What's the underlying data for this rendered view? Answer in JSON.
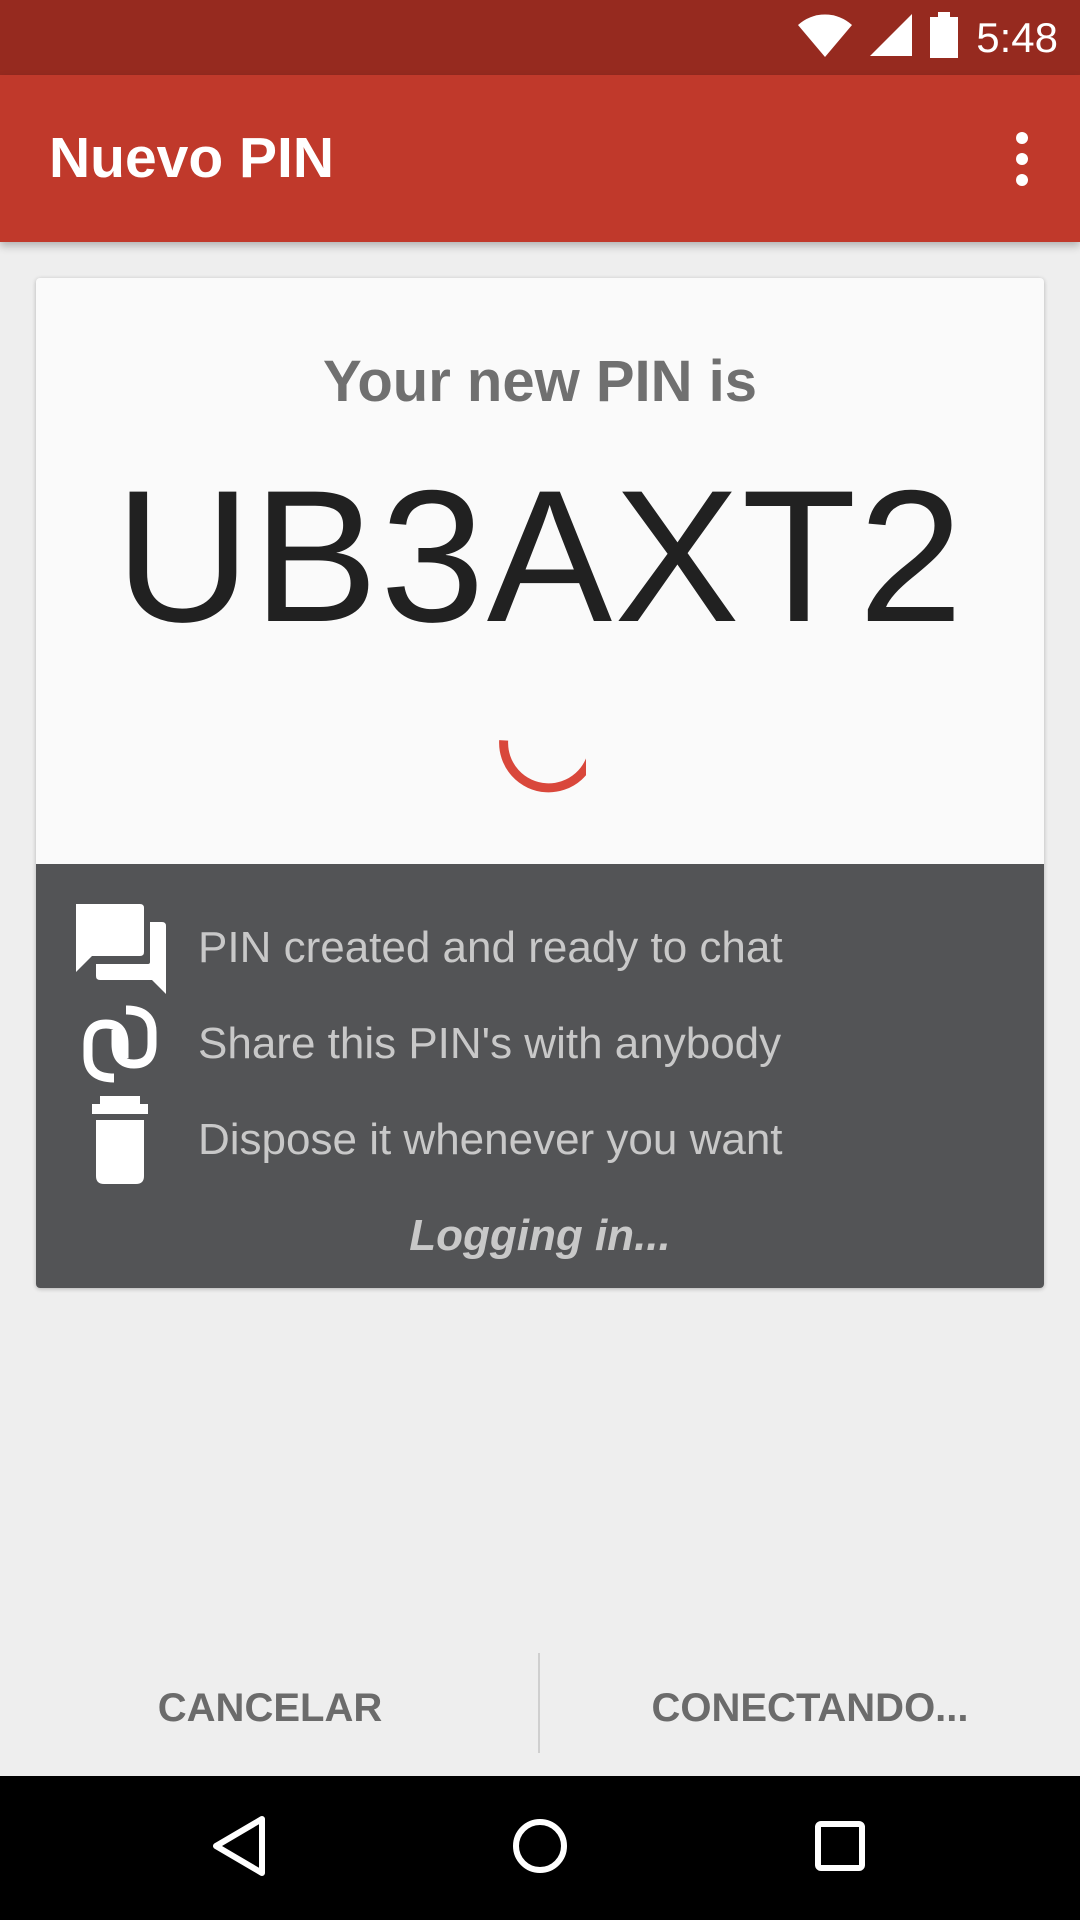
{
  "status_bar": {
    "time": "5:48",
    "icons": [
      "wifi-icon",
      "signal-icon",
      "battery-icon"
    ]
  },
  "app_bar": {
    "title": "Nuevo PIN",
    "menu_icon": "more-vert-icon"
  },
  "card": {
    "heading": "Your new PIN is",
    "pin": "UB3AXT2",
    "spinner": "loading-spinner",
    "info_items": [
      {
        "icon": "chat-bubbles-icon",
        "text": "PIN created and ready to chat"
      },
      {
        "icon": "link-icon",
        "text": "Share this PIN's with anybody"
      },
      {
        "icon": "trash-icon",
        "text": "Dispose it whenever you want"
      }
    ],
    "status_text": "Logging in..."
  },
  "actions": {
    "cancel_label": "CANCELAR",
    "connect_label": "CONECTANDO..."
  },
  "nav_bar": {
    "icons": [
      "back-icon",
      "home-icon",
      "recents-icon"
    ]
  },
  "colors": {
    "status_bar": "#962a1f",
    "app_bar": "#c0392b",
    "accent": "#d9473b",
    "info_panel": "#535456"
  }
}
